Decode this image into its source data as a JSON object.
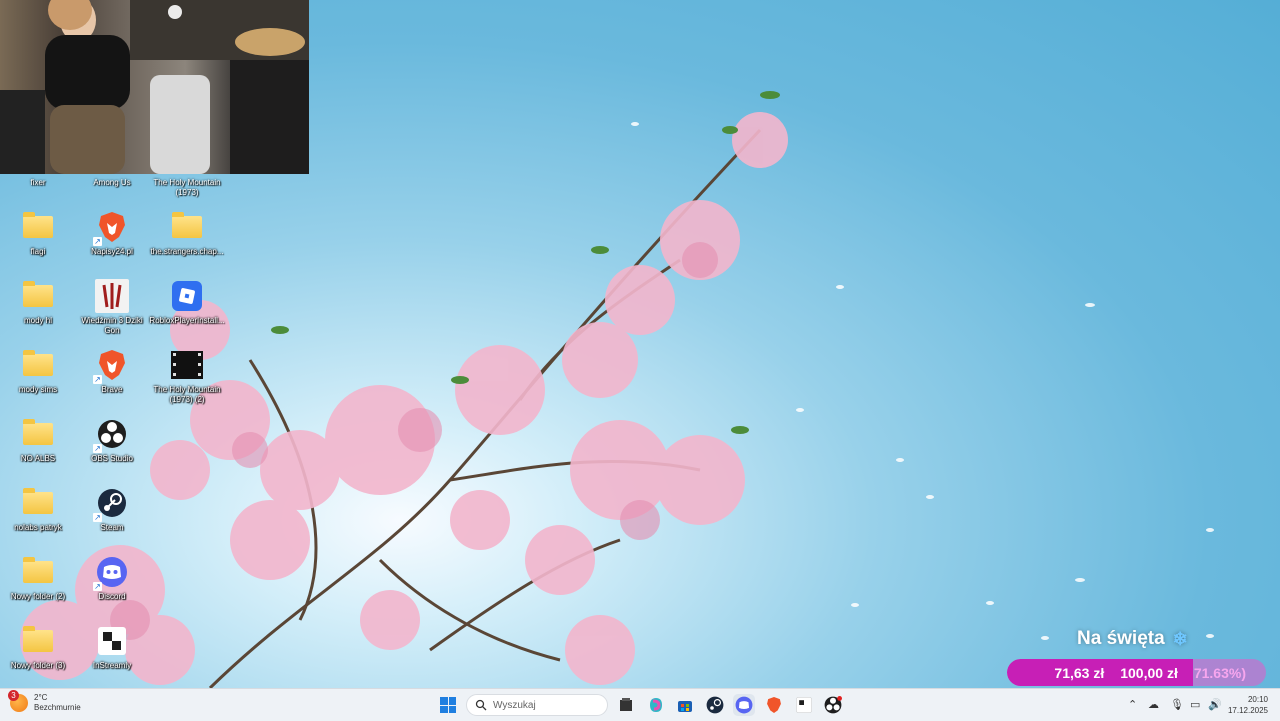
{
  "desktop": {
    "top_labels": [
      "fixer",
      "Among Us",
      "The Holy Mountain (1973)"
    ],
    "icons": [
      {
        "label": "flagi",
        "type": "folder"
      },
      {
        "label": "mody hl",
        "type": "folder"
      },
      {
        "label": "mody sims",
        "type": "folder"
      },
      {
        "label": "NO ALBS",
        "type": "folder"
      },
      {
        "label": "nolabs patryk",
        "type": "folder"
      },
      {
        "label": "Nowy folder (2)",
        "type": "folder"
      },
      {
        "label": "Nowy folder (3)",
        "type": "folder"
      },
      {
        "label": "Napisy24.pl",
        "type": "brave"
      },
      {
        "label": "Wiedźmin 3 Dziki Gon",
        "type": "witcher"
      },
      {
        "label": "Brave",
        "type": "brave"
      },
      {
        "label": "OBS Studio",
        "type": "obs"
      },
      {
        "label": "Steam",
        "type": "steam"
      },
      {
        "label": "Discord",
        "type": "discord"
      },
      {
        "label": "InStreamly",
        "type": "instreamly"
      },
      {
        "label": "the.strangers.chap...",
        "type": "folder"
      },
      {
        "label": "RobloxPlayerInstall...",
        "type": "roblox"
      },
      {
        "label": "The Holy Mountain (1973) (2)",
        "type": "film"
      }
    ]
  },
  "donation": {
    "title": "Na święta",
    "current": "71,63 zł",
    "goal": "100,00 zł",
    "percent_text": "71.63%)",
    "progress": 0.7163
  },
  "taskbar": {
    "weather_temp": "2°C",
    "weather_desc": "Bezchmurnie",
    "weather_badge": "3",
    "search_placeholder": "Wyszukaj",
    "apps": [
      "file-explorer-icon",
      "copilot-icon",
      "store-icon",
      "steam-icon",
      "discord-icon",
      "brave-icon",
      "instreamly-icon",
      "obs-icon"
    ],
    "time": "20:10",
    "date": "17.12.2025"
  },
  "colors": {
    "donation_fill": "#c71fb6",
    "donation_bg": "#e65ac8",
    "accent_blue": "#1f7fe0"
  }
}
